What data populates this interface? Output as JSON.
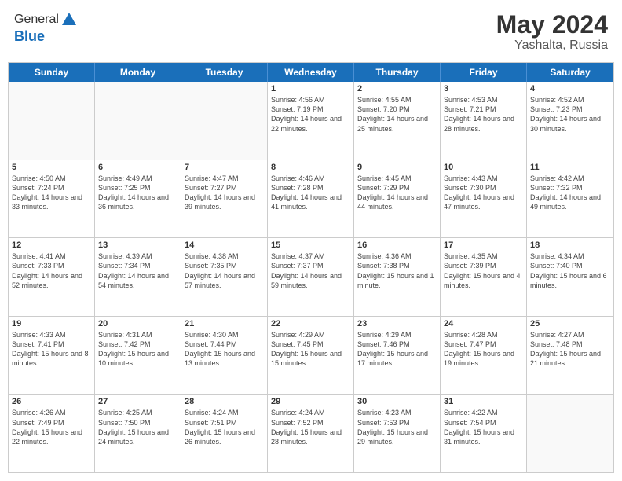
{
  "header": {
    "logo_general": "General",
    "logo_blue": "Blue",
    "month": "May 2024",
    "location": "Yashalta, Russia"
  },
  "weekdays": [
    "Sunday",
    "Monday",
    "Tuesday",
    "Wednesday",
    "Thursday",
    "Friday",
    "Saturday"
  ],
  "rows": [
    [
      {
        "day": "",
        "empty": true
      },
      {
        "day": "",
        "empty": true
      },
      {
        "day": "",
        "empty": true
      },
      {
        "day": "1",
        "sunrise": "Sunrise: 4:56 AM",
        "sunset": "Sunset: 7:19 PM",
        "daylight": "Daylight: 14 hours and 22 minutes."
      },
      {
        "day": "2",
        "sunrise": "Sunrise: 4:55 AM",
        "sunset": "Sunset: 7:20 PM",
        "daylight": "Daylight: 14 hours and 25 minutes."
      },
      {
        "day": "3",
        "sunrise": "Sunrise: 4:53 AM",
        "sunset": "Sunset: 7:21 PM",
        "daylight": "Daylight: 14 hours and 28 minutes."
      },
      {
        "day": "4",
        "sunrise": "Sunrise: 4:52 AM",
        "sunset": "Sunset: 7:23 PM",
        "daylight": "Daylight: 14 hours and 30 minutes."
      }
    ],
    [
      {
        "day": "5",
        "sunrise": "Sunrise: 4:50 AM",
        "sunset": "Sunset: 7:24 PM",
        "daylight": "Daylight: 14 hours and 33 minutes."
      },
      {
        "day": "6",
        "sunrise": "Sunrise: 4:49 AM",
        "sunset": "Sunset: 7:25 PM",
        "daylight": "Daylight: 14 hours and 36 minutes."
      },
      {
        "day": "7",
        "sunrise": "Sunrise: 4:47 AM",
        "sunset": "Sunset: 7:27 PM",
        "daylight": "Daylight: 14 hours and 39 minutes."
      },
      {
        "day": "8",
        "sunrise": "Sunrise: 4:46 AM",
        "sunset": "Sunset: 7:28 PM",
        "daylight": "Daylight: 14 hours and 41 minutes."
      },
      {
        "day": "9",
        "sunrise": "Sunrise: 4:45 AM",
        "sunset": "Sunset: 7:29 PM",
        "daylight": "Daylight: 14 hours and 44 minutes."
      },
      {
        "day": "10",
        "sunrise": "Sunrise: 4:43 AM",
        "sunset": "Sunset: 7:30 PM",
        "daylight": "Daylight: 14 hours and 47 minutes."
      },
      {
        "day": "11",
        "sunrise": "Sunrise: 4:42 AM",
        "sunset": "Sunset: 7:32 PM",
        "daylight": "Daylight: 14 hours and 49 minutes."
      }
    ],
    [
      {
        "day": "12",
        "sunrise": "Sunrise: 4:41 AM",
        "sunset": "Sunset: 7:33 PM",
        "daylight": "Daylight: 14 hours and 52 minutes."
      },
      {
        "day": "13",
        "sunrise": "Sunrise: 4:39 AM",
        "sunset": "Sunset: 7:34 PM",
        "daylight": "Daylight: 14 hours and 54 minutes."
      },
      {
        "day": "14",
        "sunrise": "Sunrise: 4:38 AM",
        "sunset": "Sunset: 7:35 PM",
        "daylight": "Daylight: 14 hours and 57 minutes."
      },
      {
        "day": "15",
        "sunrise": "Sunrise: 4:37 AM",
        "sunset": "Sunset: 7:37 PM",
        "daylight": "Daylight: 14 hours and 59 minutes."
      },
      {
        "day": "16",
        "sunrise": "Sunrise: 4:36 AM",
        "sunset": "Sunset: 7:38 PM",
        "daylight": "Daylight: 15 hours and 1 minute."
      },
      {
        "day": "17",
        "sunrise": "Sunrise: 4:35 AM",
        "sunset": "Sunset: 7:39 PM",
        "daylight": "Daylight: 15 hours and 4 minutes."
      },
      {
        "day": "18",
        "sunrise": "Sunrise: 4:34 AM",
        "sunset": "Sunset: 7:40 PM",
        "daylight": "Daylight: 15 hours and 6 minutes."
      }
    ],
    [
      {
        "day": "19",
        "sunrise": "Sunrise: 4:33 AM",
        "sunset": "Sunset: 7:41 PM",
        "daylight": "Daylight: 15 hours and 8 minutes."
      },
      {
        "day": "20",
        "sunrise": "Sunrise: 4:31 AM",
        "sunset": "Sunset: 7:42 PM",
        "daylight": "Daylight: 15 hours and 10 minutes."
      },
      {
        "day": "21",
        "sunrise": "Sunrise: 4:30 AM",
        "sunset": "Sunset: 7:44 PM",
        "daylight": "Daylight: 15 hours and 13 minutes."
      },
      {
        "day": "22",
        "sunrise": "Sunrise: 4:29 AM",
        "sunset": "Sunset: 7:45 PM",
        "daylight": "Daylight: 15 hours and 15 minutes."
      },
      {
        "day": "23",
        "sunrise": "Sunrise: 4:29 AM",
        "sunset": "Sunset: 7:46 PM",
        "daylight": "Daylight: 15 hours and 17 minutes."
      },
      {
        "day": "24",
        "sunrise": "Sunrise: 4:28 AM",
        "sunset": "Sunset: 7:47 PM",
        "daylight": "Daylight: 15 hours and 19 minutes."
      },
      {
        "day": "25",
        "sunrise": "Sunrise: 4:27 AM",
        "sunset": "Sunset: 7:48 PM",
        "daylight": "Daylight: 15 hours and 21 minutes."
      }
    ],
    [
      {
        "day": "26",
        "sunrise": "Sunrise: 4:26 AM",
        "sunset": "Sunset: 7:49 PM",
        "daylight": "Daylight: 15 hours and 22 minutes."
      },
      {
        "day": "27",
        "sunrise": "Sunrise: 4:25 AM",
        "sunset": "Sunset: 7:50 PM",
        "daylight": "Daylight: 15 hours and 24 minutes."
      },
      {
        "day": "28",
        "sunrise": "Sunrise: 4:24 AM",
        "sunset": "Sunset: 7:51 PM",
        "daylight": "Daylight: 15 hours and 26 minutes."
      },
      {
        "day": "29",
        "sunrise": "Sunrise: 4:24 AM",
        "sunset": "Sunset: 7:52 PM",
        "daylight": "Daylight: 15 hours and 28 minutes."
      },
      {
        "day": "30",
        "sunrise": "Sunrise: 4:23 AM",
        "sunset": "Sunset: 7:53 PM",
        "daylight": "Daylight: 15 hours and 29 minutes."
      },
      {
        "day": "31",
        "sunrise": "Sunrise: 4:22 AM",
        "sunset": "Sunset: 7:54 PM",
        "daylight": "Daylight: 15 hours and 31 minutes."
      },
      {
        "day": "",
        "empty": true
      }
    ]
  ]
}
